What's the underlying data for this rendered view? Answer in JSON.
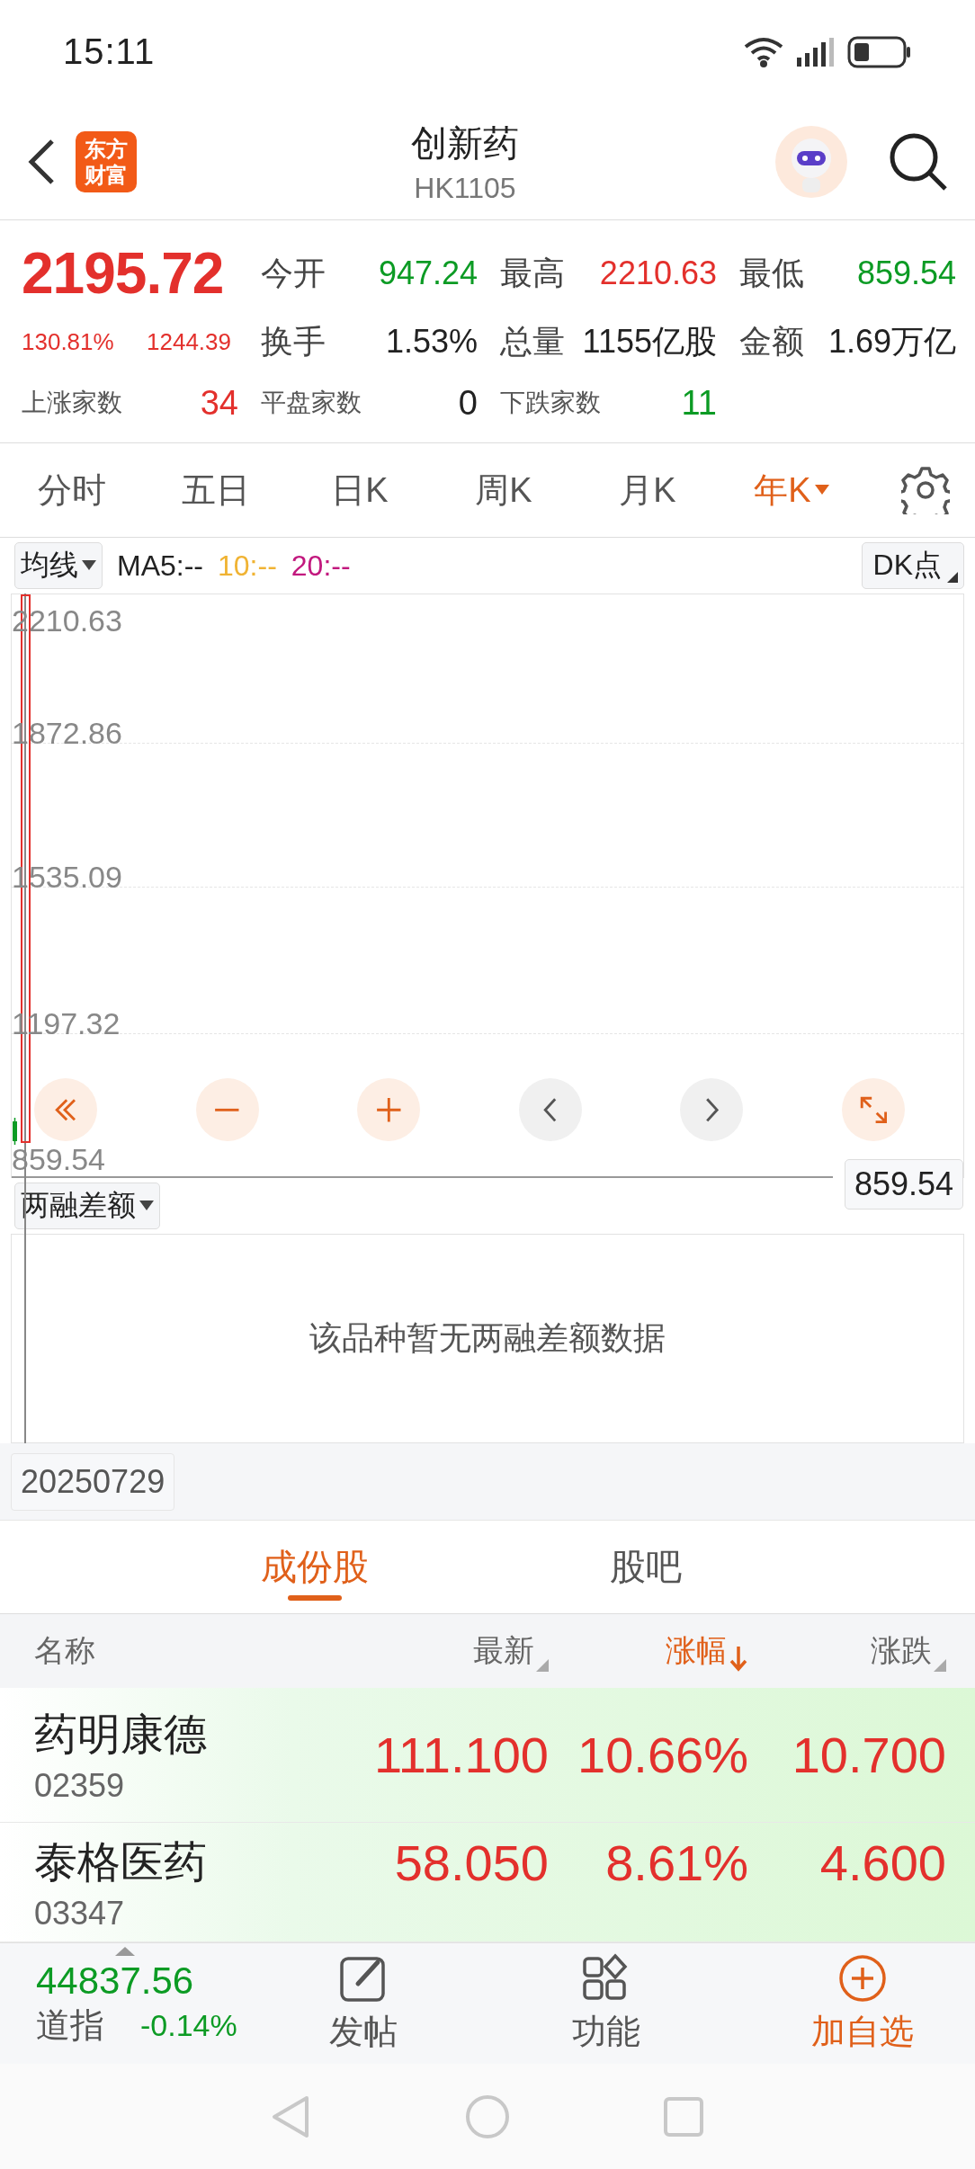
{
  "status_bar": {
    "time": "15:11"
  },
  "header": {
    "logo_lines": [
      "东方",
      "财富"
    ],
    "title": "创新药",
    "code": "HK1105"
  },
  "quote": {
    "price": "2195.72",
    "change_pct": "130.81%",
    "change": "1244.39",
    "stats": [
      {
        "label": "今开",
        "value": "947.24",
        "color": "#0c9b24"
      },
      {
        "label": "最高",
        "value": "2210.63",
        "color": "#e3302c"
      },
      {
        "label": "最低",
        "value": "859.54",
        "color": "#0c9b24"
      },
      {
        "label": "换手",
        "value": "1.53%",
        "color": "#222222"
      },
      {
        "label": "总量",
        "value": "1155亿股",
        "color": "#222222"
      },
      {
        "label": "金额",
        "value": "1.69万亿",
        "color": "#222222"
      }
    ],
    "breadth": [
      {
        "label": "上涨家数",
        "value": "34",
        "color": "#e3302c"
      },
      {
        "label": "平盘家数",
        "value": "0",
        "color": "#222222"
      },
      {
        "label": "下跌家数",
        "value": "11",
        "color": "#0c9b24"
      }
    ]
  },
  "period_tabs": [
    {
      "label": "分时",
      "selected": false,
      "has_menu": false
    },
    {
      "label": "五日",
      "selected": false,
      "has_menu": false
    },
    {
      "label": "日K",
      "selected": false,
      "has_menu": false
    },
    {
      "label": "周K",
      "selected": false,
      "has_menu": false
    },
    {
      "label": "月K",
      "selected": false,
      "has_menu": false
    },
    {
      "label": "年K",
      "selected": true,
      "has_menu": true
    }
  ],
  "indicator": {
    "selector": "均线",
    "ma": [
      {
        "label": "MA5:--",
        "color": "#222222"
      },
      {
        "label": "10:--",
        "color": "#f0b333"
      },
      {
        "label": "20:--",
        "color": "#c2187e"
      }
    ],
    "dk_button": "DK点"
  },
  "chart": {
    "y_labels": [
      "2210.63",
      "1872.86",
      "1535.09",
      "1197.32",
      "859.54"
    ],
    "crosshair_value": "859.54",
    "controls": [
      {
        "kind": "double-left",
        "accent": true
      },
      {
        "kind": "minus",
        "accent": true
      },
      {
        "kind": "plus",
        "accent": true
      },
      {
        "kind": "left",
        "accent": false
      },
      {
        "kind": "right",
        "accent": false
      },
      {
        "kind": "expand",
        "accent": true
      }
    ]
  },
  "sub_chart": {
    "selector": "两融差额",
    "empty_message": "该品种暂无两融差额数据",
    "date": "20250729"
  },
  "list_tabs": [
    {
      "label": "成份股",
      "selected": true
    },
    {
      "label": "股吧",
      "selected": false
    }
  ],
  "table": {
    "columns": [
      {
        "label": "名称",
        "sortable": false,
        "sorted": false
      },
      {
        "label": "最新",
        "sortable": true,
        "sorted": false
      },
      {
        "label": "涨幅",
        "sortable": true,
        "sorted": true
      },
      {
        "label": "涨跌",
        "sortable": true,
        "sorted": false
      }
    ],
    "rows": [
      {
        "name": "药明康德",
        "code": "02359",
        "latest": "111.100",
        "change_pct": "10.66%",
        "change": "10.700"
      },
      {
        "name": "泰格医药",
        "code": "03347",
        "latest": "58.050",
        "change_pct": "8.61%",
        "change": "4.600"
      }
    ]
  },
  "bottom_bar": {
    "index_value": "44837.56",
    "index_name": "道指",
    "index_change": "-0.14%",
    "actions": [
      {
        "label": "发帖",
        "kind": "post",
        "highlighted": false
      },
      {
        "label": "功能",
        "kind": "apps",
        "highlighted": false
      },
      {
        "label": "加自选",
        "kind": "add",
        "highlighted": true
      }
    ]
  }
}
